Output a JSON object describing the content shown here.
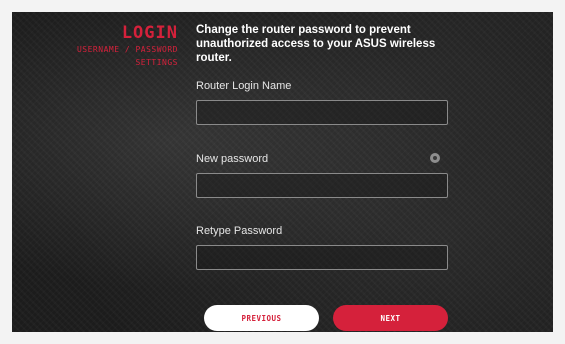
{
  "sidebar": {
    "title": "LOGIN",
    "subtitle_line1": "USERNAME / PASSWORD",
    "subtitle_line2": "SETTINGS"
  },
  "main": {
    "description": "Change the router password to prevent unauthorized access to your ASUS wireless router.",
    "fields": [
      {
        "label": "Router Login Name",
        "value": "",
        "placeholder": ""
      },
      {
        "label": "New password",
        "value": "",
        "placeholder": ""
      },
      {
        "label": "Retype Password",
        "value": "",
        "placeholder": ""
      }
    ],
    "show_password_icon": "eye-icon"
  },
  "buttons": {
    "previous_label": "PREVIOUS",
    "next_label": "NEXT"
  },
  "colors": {
    "accent": "#d5213b",
    "background": "#1c1c1c",
    "text": "#ffffff"
  }
}
